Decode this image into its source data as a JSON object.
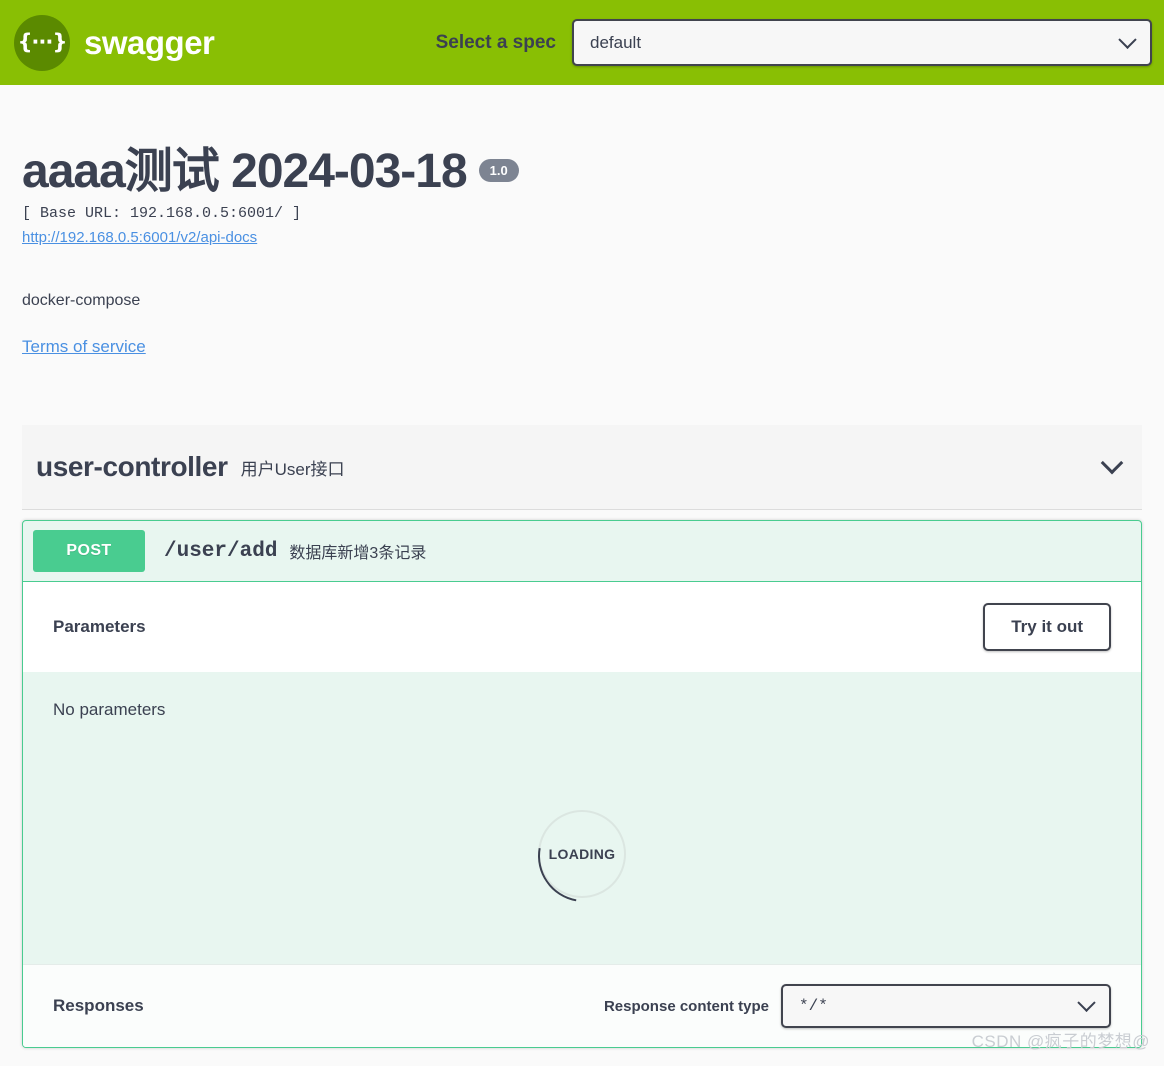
{
  "topbar": {
    "logo_glyph": "{∙∙∙}",
    "logo_text": "swagger",
    "select_spec_label": "Select a spec",
    "spec_select_value": "default"
  },
  "info": {
    "title": "aaaa测试 2024-03-18",
    "version": "1.0",
    "base_url": "[ Base URL: 192.168.0.5:6001/ ]",
    "api_docs_link": "http://192.168.0.5:6001/v2/api-docs",
    "description": "docker-compose",
    "terms_of_service": "Terms of service"
  },
  "tag": {
    "name": "user-controller",
    "description": "用户User接口"
  },
  "operation": {
    "method": "POST",
    "path": "/user/add",
    "summary": "数据库新增3条记录",
    "parameters_title": "Parameters",
    "try_it_out_label": "Try it out",
    "no_parameters_text": "No parameters",
    "loading_text": "LOADING",
    "responses_title": "Responses",
    "response_content_type_label": "Response content type",
    "response_content_type_value": "*/*"
  },
  "watermark": "CSDN @疯子的梦想@",
  "colors": {
    "brand_green": "#89bf04",
    "post_green": "#49cc90",
    "op_bg": "#e8f6f0",
    "text": "#3b4151",
    "link": "#4a90e2",
    "version_badge": "#7d8492"
  }
}
